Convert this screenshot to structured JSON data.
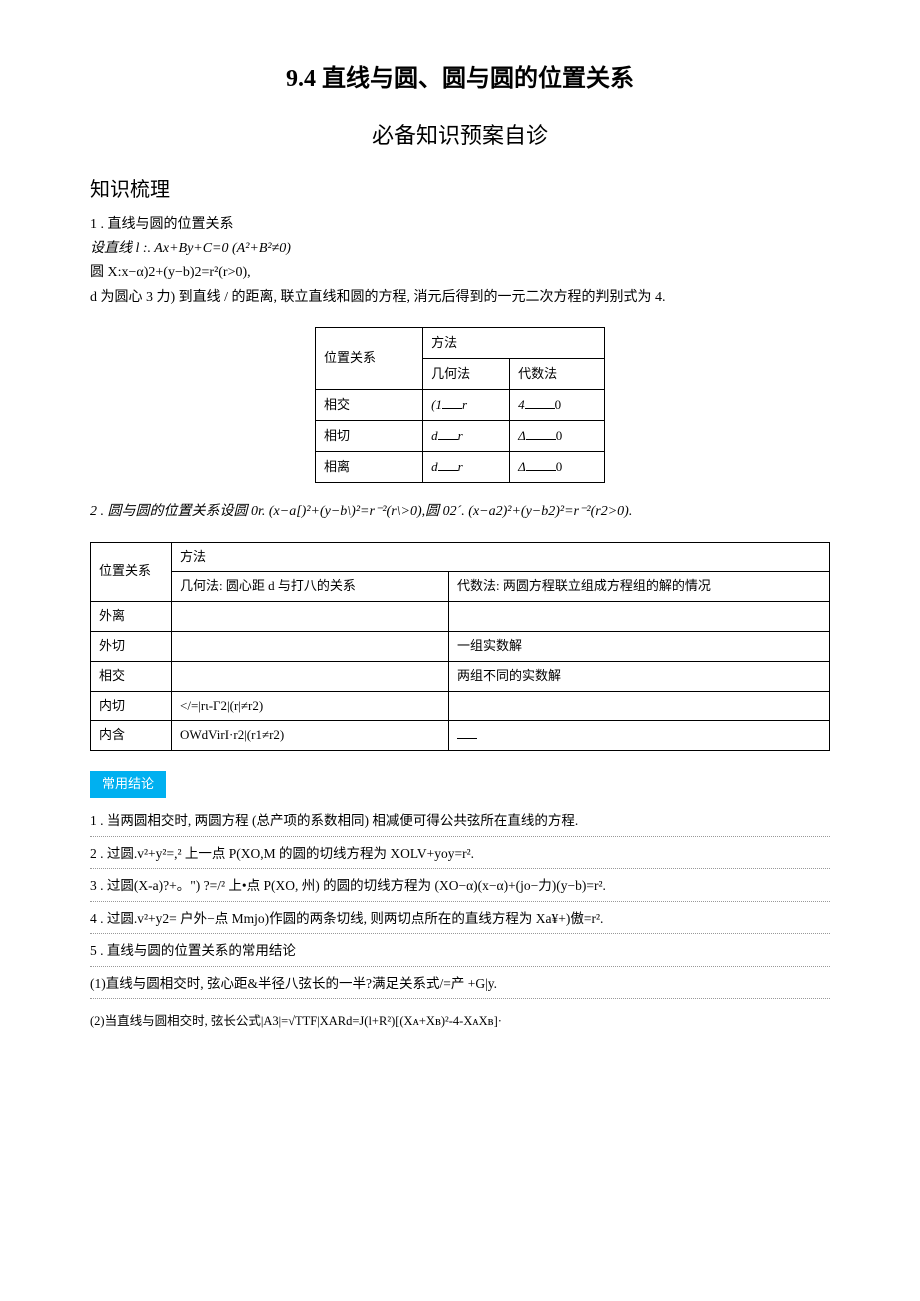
{
  "titles": {
    "main": "9.4 直线与圆、圆与圆的位置关系",
    "sub": "必备知识预案自诊",
    "h2": "知识梳理"
  },
  "sec1": {
    "h": "1 . 直线与圆的位置关系",
    "l1": "设直线 l :. Ax+By+C=0 (A²+B²≠0)",
    "l2": "圆 X:x−α)2+(y−b)2=r²(r>0),",
    "l3": "d 为圆心 3 力) 到直线 / 的距离, 联立直线和圆的方程, 消元后得到的一元二次方程的判别式为 4."
  },
  "t1": {
    "h_pos": "位置关系",
    "h_method": "方法",
    "h_geo": "几何法",
    "h_alg": "代数法",
    "r1": {
      "pos": "相交",
      "geo_a": "(1",
      "geo_b": "r",
      "alg_a": "4",
      "alg_b": "0"
    },
    "r2": {
      "pos": "相切",
      "geo_a": "d",
      "geo_b": "r",
      "alg_a": "Δ",
      "alg_b": "0"
    },
    "r3": {
      "pos": "相离",
      "geo_a": "d",
      "geo_b": "r",
      "alg_a": "Δ",
      "alg_b": "0"
    }
  },
  "sec2": {
    "h": "2 . 圆与圆的位置关系设圆 0r. (x−a[)²+(y−b\\)²=r⁻²(r\\>0),圆 02´. (x−a2)²+(y−b2)²=r⁻²(r2>0)."
  },
  "t2": {
    "h_pos": "位置关系",
    "h_method": "方法",
    "h_geo": "几何法: 圆心距 d 与打八的关系",
    "h_alg": "代数法: 两圆方程联立组成方程组的解的情况",
    "r1": {
      "pos": "外离",
      "geo": "",
      "alg": ""
    },
    "r2": {
      "pos": "外切",
      "geo": "",
      "alg": "一组实数解"
    },
    "r3": {
      "pos": "相交",
      "geo": "",
      "alg": "两组不同的实数解"
    },
    "r4": {
      "pos": "内切",
      "geo": "</=|rι-Γ2|(r|≠r2)",
      "alg": ""
    },
    "r5": {
      "pos": "内含",
      "geo": "OWdVirI·r2|(r1≠r2)",
      "alg": ""
    }
  },
  "blue": "常用结论",
  "conc": {
    "l1": "1 . 当两圆相交时, 两圆方程 (总产项的系数相同) 相减便可得公共弦所在直线的方程.",
    "l2": "2 . 过圆.v²+y²=,² 上一点 P(XO,M 的圆的切线方程为 XOLV+yoy=r².",
    "l3": "3 . 过圆(X-a)?+。\") ?=/² 上•点 P(XO, 州) 的圆的切线方程为 (XO−α)(x−α)+(jo−力)(y−b)=r².",
    "l4": "4 . 过圆.v²+y2= 户外−点 Mmjo)作圆的两条切线, 则两切点所在的直线方程为 Xa¥+)傲=r².",
    "l5": "5 . 直线与圆的位置关系的常用结论",
    "l6": "(1)直线与圆相交时, 弦心距&半径八弦长的一半?满足关系式/=产 +G|y."
  },
  "footer": "(2)当直线与圆相交时, 弦长公式|A3|=√TTF|XARd=J(l+R²)[(Xᴀ+Xʙ)²-4-XᴀXʙ]·"
}
